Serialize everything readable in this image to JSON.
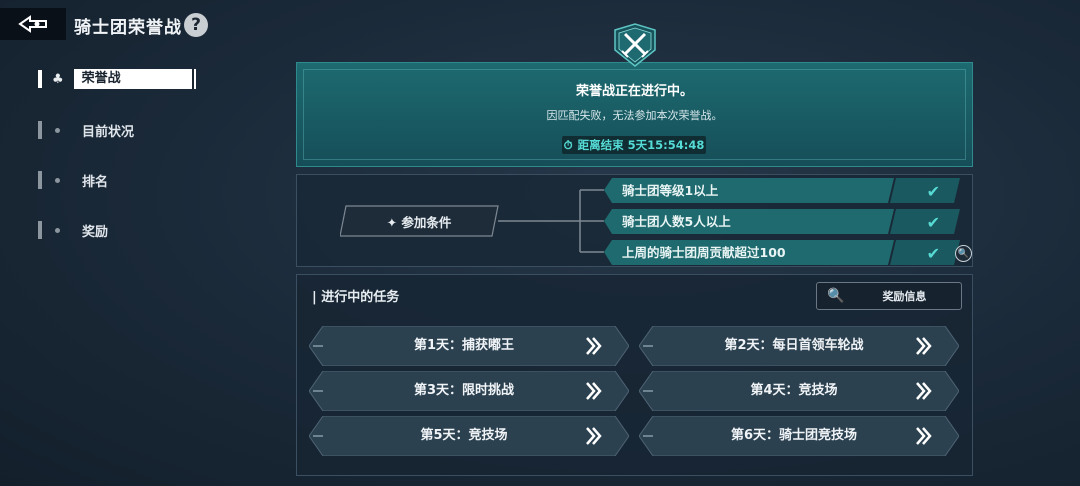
{
  "header": {
    "title": "骑士团荣誉战",
    "help_glyph": "?"
  },
  "sidebar": {
    "items": [
      {
        "label": "荣誉战",
        "active": true
      },
      {
        "label": "目前状况",
        "active": false
      },
      {
        "label": "排名",
        "active": false
      },
      {
        "label": "奖励",
        "active": false
      }
    ]
  },
  "banner": {
    "title": "荣誉战正在进行中。",
    "subtitle": "因匹配失败，无法参加本次荣誉战。",
    "countdown": "距离结束 5天15:54:48"
  },
  "conditions": {
    "label": "✦ 参加条件",
    "items": [
      {
        "text": "骑士团等级1以上",
        "met": true
      },
      {
        "text": "骑士团人数5人以上",
        "met": true
      },
      {
        "text": "上周的骑士团周贡献超过100",
        "met": true
      }
    ]
  },
  "tasks": {
    "title": "| 进行中的任务",
    "reward_button": "奖励信息",
    "items": [
      {
        "label": "第1天：捕获嘟王"
      },
      {
        "label": "第2天：每日首领车轮战"
      },
      {
        "label": "第3天：限时挑战"
      },
      {
        "label": "第4天：竞技场"
      },
      {
        "label": "第5天：竞技场"
      },
      {
        "label": "第6天：骑士团竞技场"
      }
    ]
  },
  "colors": {
    "accent": "#55dcd6",
    "banner": "#1d6a70",
    "panel": "#1c2b3a"
  }
}
